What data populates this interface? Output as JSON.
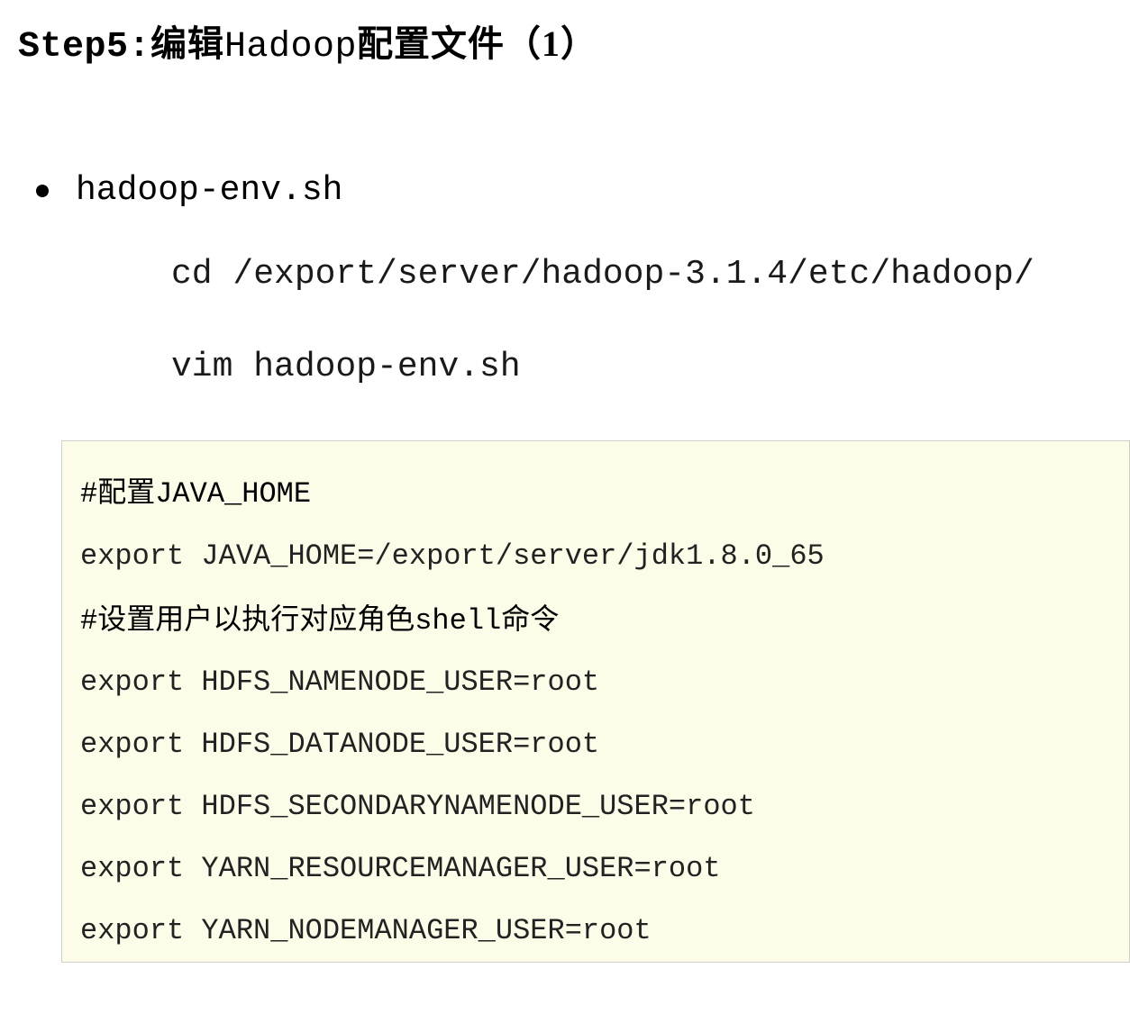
{
  "title": {
    "prefix": "Step5:",
    "cn1": "编辑",
    "mono": "Hadoop",
    "cn2": "配置文件（1）"
  },
  "bullet": {
    "text": "hadoop-env.sh"
  },
  "commands": {
    "line1": "cd /export/server/hadoop-3.1.4/etc/hadoop/",
    "line2": "vim hadoop-env.sh"
  },
  "code": {
    "c1_hash": "#",
    "c1_cn": "配置",
    "c1_tail": "JAVA_HOME",
    "l1": "export JAVA_HOME=/export/server/jdk1.8.0_65",
    "c2_hash": "#",
    "c2_cn1": "设置用户以执行对应角色",
    "c2_mono": "shell",
    "c2_cn2": "命令",
    "l2": "export HDFS_NAMENODE_USER=root",
    "l3": "export HDFS_DATANODE_USER=root",
    "l4": "export HDFS_SECONDARYNAMENODE_USER=root",
    "l5": "export YARN_RESOURCEMANAGER_USER=root",
    "l6": "export YARN_NODEMANAGER_USER=root"
  }
}
